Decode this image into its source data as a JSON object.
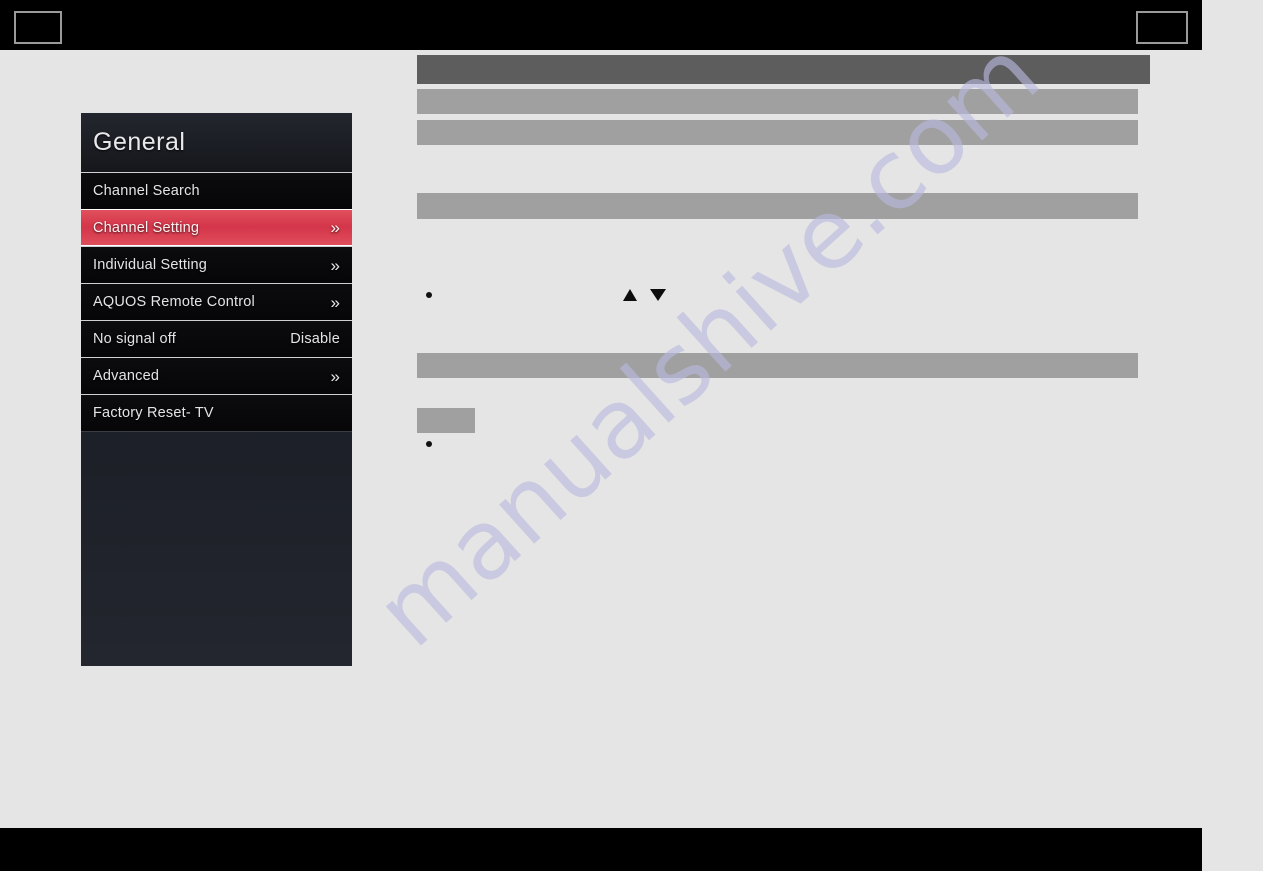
{
  "page": {
    "background_color": "#e5e5e5",
    "band_color": "#000000",
    "watermark": "manualshive.com"
  },
  "top_band": {
    "left_box_label": "",
    "right_box_label": ""
  },
  "bottom_band": {
    "label": ""
  },
  "content": {
    "redacted_bars": [
      {
        "name": "section-title-bar",
        "tone": "dark",
        "color": "#5d5d5d"
      },
      {
        "name": "body-line-1",
        "tone": "light",
        "color": "#a0a0a0"
      },
      {
        "name": "body-line-2",
        "tone": "light",
        "color": "#a0a0a0"
      },
      {
        "name": "subsection-bar",
        "tone": "light",
        "color": "#a0a0a0"
      },
      {
        "name": "subsection-bar-2",
        "tone": "light",
        "color": "#a0a0a0"
      },
      {
        "name": "note-chip",
        "tone": "light",
        "color": "#a0a0a0"
      }
    ],
    "bullets": [
      "",
      ""
    ],
    "arrows": {
      "up": "▲",
      "down": "▼"
    }
  },
  "osd": {
    "title": "General",
    "accent_color": "#d4354a",
    "items": [
      {
        "label": "Channel Search",
        "value": "",
        "chevron": "",
        "selected": false
      },
      {
        "label": "Channel Setting",
        "value": "",
        "chevron": "»",
        "selected": true
      },
      {
        "label": "Individual Setting",
        "value": "",
        "chevron": "»",
        "selected": false
      },
      {
        "label": "AQUOS Remote Control",
        "value": "",
        "chevron": "»",
        "selected": false
      },
      {
        "label": "No signal off",
        "value": "Disable",
        "chevron": "",
        "selected": false
      },
      {
        "label": "Advanced",
        "value": "",
        "chevron": "»",
        "selected": false
      },
      {
        "label": "Factory Reset- TV",
        "value": "",
        "chevron": "",
        "selected": false
      }
    ]
  }
}
